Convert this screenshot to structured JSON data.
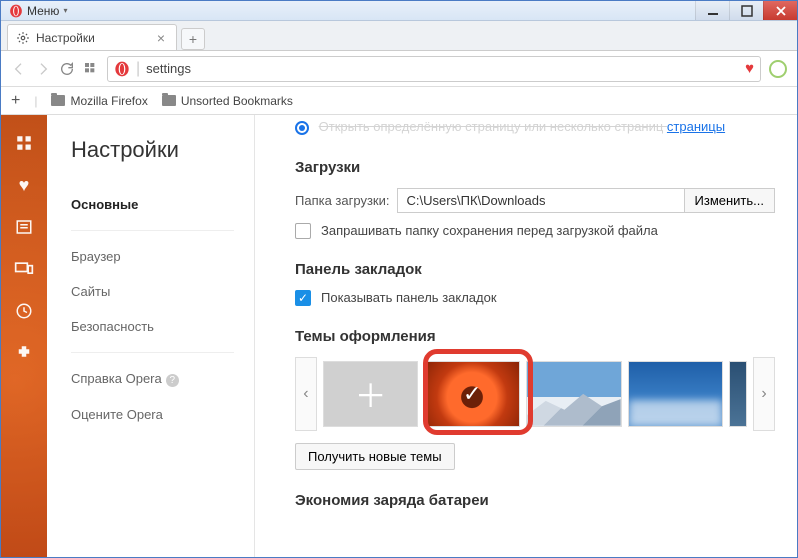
{
  "window": {
    "menu_label": "Меню"
  },
  "tab": {
    "title": "Настройки"
  },
  "address": {
    "value": "settings"
  },
  "bookmarks_bar": {
    "items": [
      "Mozilla Firefox",
      "Unsorted Bookmarks"
    ]
  },
  "sidebar": {
    "title": "Настройки",
    "items": [
      {
        "label": "Основные",
        "active": true
      },
      {
        "label": "Браузер"
      },
      {
        "label": "Сайты"
      },
      {
        "label": "Безопасность"
      }
    ],
    "help": "Справка Opera",
    "rate": "Оцените Opera"
  },
  "content": {
    "startup_link": "страницы",
    "downloads": {
      "heading": "Загрузки",
      "folder_label": "Папка загрузки:",
      "folder_value": "C:\\Users\\ПК\\Downloads",
      "change_btn": "Изменить...",
      "ask_checkbox": "Запрашивать папку сохранения перед загрузкой файла"
    },
    "bookmarks_panel": {
      "heading": "Панель закладок",
      "show_checkbox": "Показывать панель закладок"
    },
    "themes": {
      "heading": "Темы оформления",
      "get_more": "Получить новые темы"
    },
    "battery": {
      "heading": "Экономия заряда батареи"
    }
  }
}
